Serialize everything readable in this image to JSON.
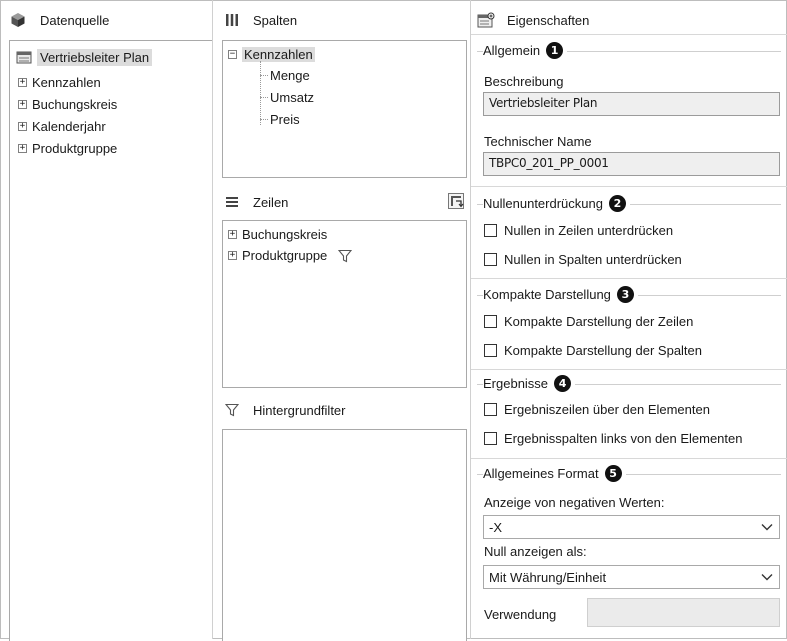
{
  "left": {
    "header": "Datenquelle",
    "tree": [
      {
        "label": "Vertriebsleiter Plan",
        "selected": true
      },
      {
        "label": "Kennzahlen"
      },
      {
        "label": "Buchungskreis"
      },
      {
        "label": "Kalenderjahr"
      },
      {
        "label": "Produktgruppe"
      }
    ]
  },
  "columns": {
    "header": "Spalten",
    "root": "Kennzahlen",
    "root_toggle": "−",
    "children": [
      "Menge",
      "Umsatz",
      "Preis"
    ]
  },
  "rows": {
    "header": "Zeilen",
    "items": [
      "Buchungskreis",
      "Produktgruppe"
    ],
    "toggle": "+"
  },
  "filter": {
    "header": "Hintergrundfilter"
  },
  "properties": {
    "header": "Eigenschaften",
    "sections": {
      "general": {
        "title": "Allgemein",
        "badge": "1",
        "description_label": "Beschreibung",
        "description_value": "Vertriebsleiter Plan",
        "techname_label": "Technischer Name",
        "techname_value": "TBPC0_201_PP_0001"
      },
      "zero": {
        "title": "Nullenunterdrückung",
        "badge": "2",
        "opt1": "Nullen in Zeilen unterdrücken",
        "opt2": "Nullen in Spalten unterdrücken"
      },
      "compact": {
        "title": "Kompakte Darstellung",
        "badge": "3",
        "opt1": "Kompakte Darstellung der Zeilen",
        "opt2": "Kompakte Darstellung der Spalten"
      },
      "results": {
        "title": "Ergebnisse",
        "badge": "4",
        "opt1": "Ergebniszeilen über den Elementen",
        "opt2": "Ergebnisspalten links von den Elementen"
      },
      "format": {
        "title": "Allgemeines Format",
        "badge": "5",
        "neg_label": "Anzeige von negativen Werten:",
        "neg_value": "-X",
        "null_label": "Null anzeigen als:",
        "null_value": "Mit Währung/Einheit",
        "usage_label": "Verwendung",
        "usage_value": ""
      }
    }
  }
}
